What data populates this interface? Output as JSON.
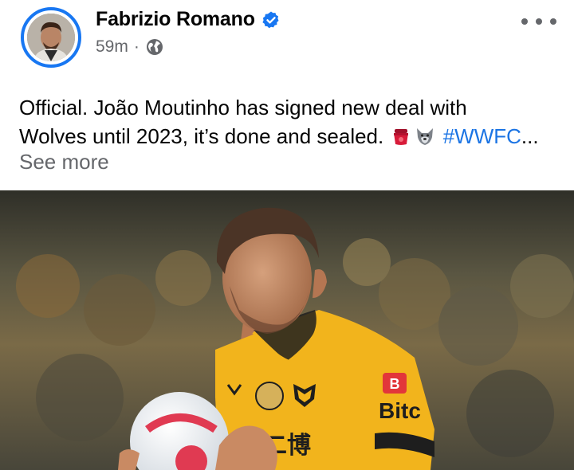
{
  "post": {
    "author": {
      "name": "Fabrizio Romano",
      "verified": true,
      "avatar_icon": "profile-photo"
    },
    "timestamp": "59m",
    "separator": "·",
    "privacy_icon": "globe-icon",
    "menu_icon": "more-horizontal-icon",
    "text": {
      "line1": "Official. João Moutinho has signed new deal with",
      "line2_prefix": "Wolves until 2023, it’s done and sealed.",
      "emojis": [
        "seal-emoji",
        "wolf-emoji"
      ],
      "hashtag": "#WWFC",
      "ellipsis": "..."
    },
    "see_more": "See more",
    "image": {
      "jersey_sponsor": "Bitc",
      "jersey_badge": "B",
      "jersey_text": "二博"
    }
  },
  "colors": {
    "accent": "#1877f2",
    "hashtag": "#1b74e4",
    "muted": "#65676b",
    "jersey": "#f2b41c"
  }
}
